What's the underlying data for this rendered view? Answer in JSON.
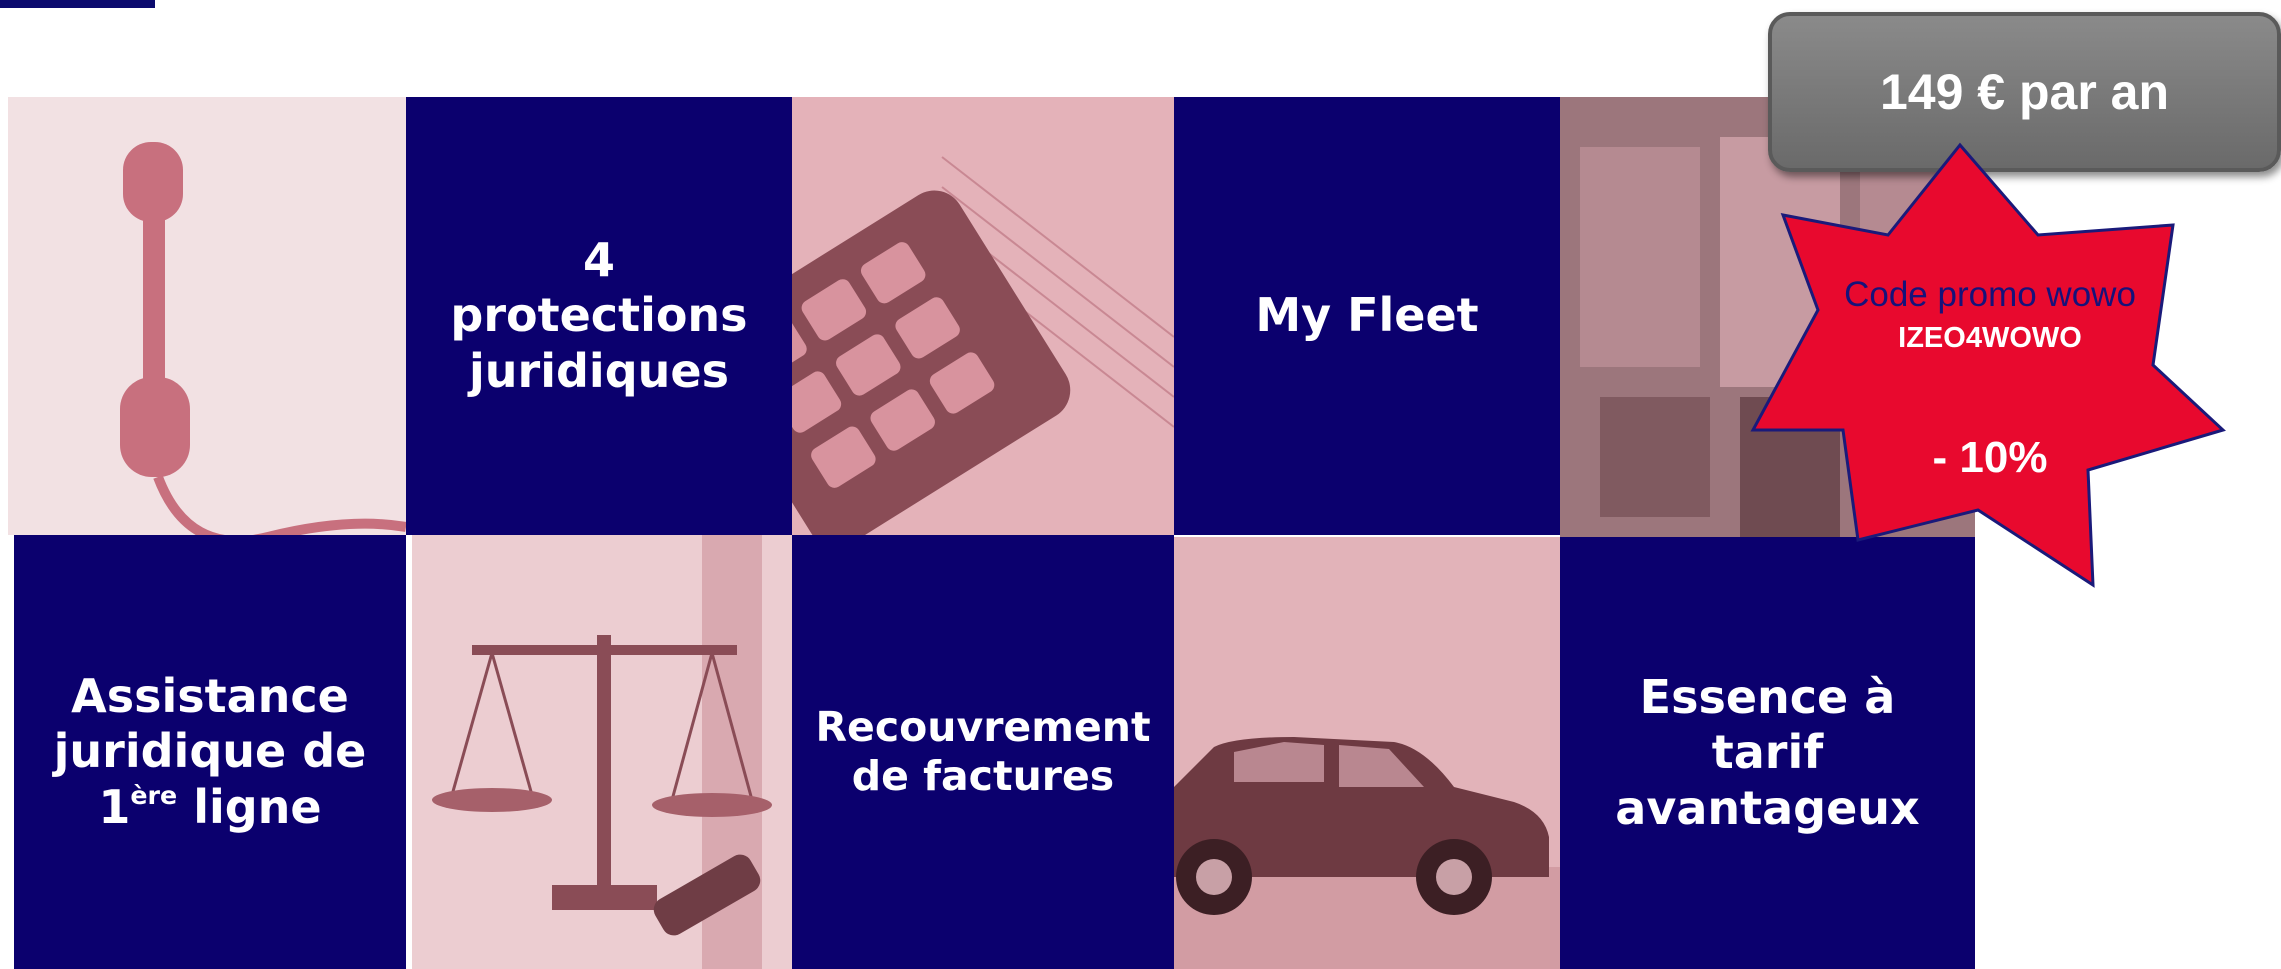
{
  "tiles": {
    "protections": "4\nprotections\njuridiques",
    "my_fleet": "My Fleet",
    "assistance": {
      "line1": "Assistance",
      "line2": "juridique de",
      "line3_prefix": "1",
      "line3_sup": "ère",
      "line3_suffix": " ligne"
    },
    "recouvrement": "Recouvrement\nde factures",
    "essence": "Essence à\ntarif\navantageux"
  },
  "price": {
    "label": "149 € par an"
  },
  "promo": {
    "label": "Code promo wowo",
    "code": "IZEO4WOWO",
    "discount": "- 10%"
  },
  "colors": {
    "navy": "#0b006e",
    "promo_red": "#e8092e",
    "price_gray": "#7a7a7a",
    "photo_tint": "#e9c3c8"
  },
  "icons": [
    "telephone-icon",
    "calculator-icon",
    "fuel-pump-icon",
    "scales-of-justice-icon",
    "car-icon"
  ]
}
